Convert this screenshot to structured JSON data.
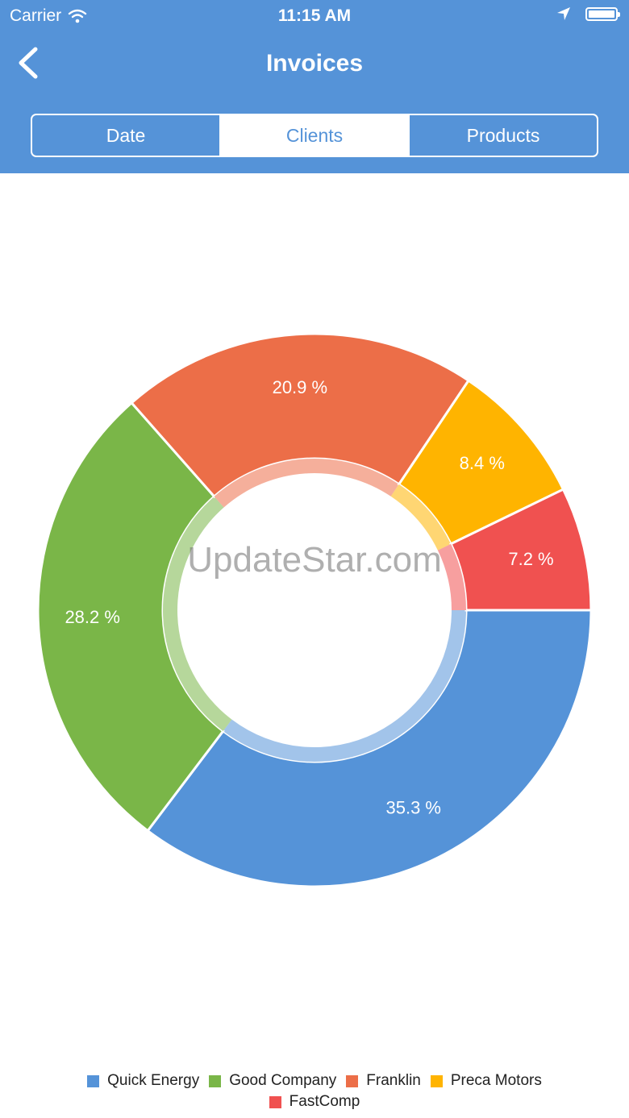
{
  "status_bar": {
    "carrier": "Carrier",
    "time": "11:15 AM"
  },
  "nav": {
    "title": "Invoices"
  },
  "tabs": [
    {
      "label": "Date",
      "active": false
    },
    {
      "label": "Clients",
      "active": true
    },
    {
      "label": "Products",
      "active": false
    }
  ],
  "watermark": "UpdateStar.com",
  "icons": {
    "back": "chevron-left-icon",
    "wifi": "wifi-icon",
    "location": "location-arrow-icon",
    "battery": "battery-icon"
  },
  "colors": {
    "header": "#5593d8"
  },
  "chart_data": {
    "type": "pie",
    "style": "donut",
    "legend_position": "bottom",
    "start_angle_deg": 90,
    "direction": "clockwise",
    "slices": [
      {
        "name": "Quick Energy",
        "value": 35.3,
        "label": "35.3 %",
        "color": "#5593d8"
      },
      {
        "name": "Good Company",
        "value": 28.2,
        "label": "28.2 %",
        "color": "#7ab648"
      },
      {
        "name": "Franklin",
        "value": 20.9,
        "label": "20.9 %",
        "color": "#ec6e48"
      },
      {
        "name": "Preca Motors",
        "value": 8.4,
        "label": "8.4 %",
        "color": "#ffb400"
      },
      {
        "name": "FastComp",
        "value": 7.2,
        "label": "7.2 %",
        "color": "#f05150"
      }
    ]
  }
}
